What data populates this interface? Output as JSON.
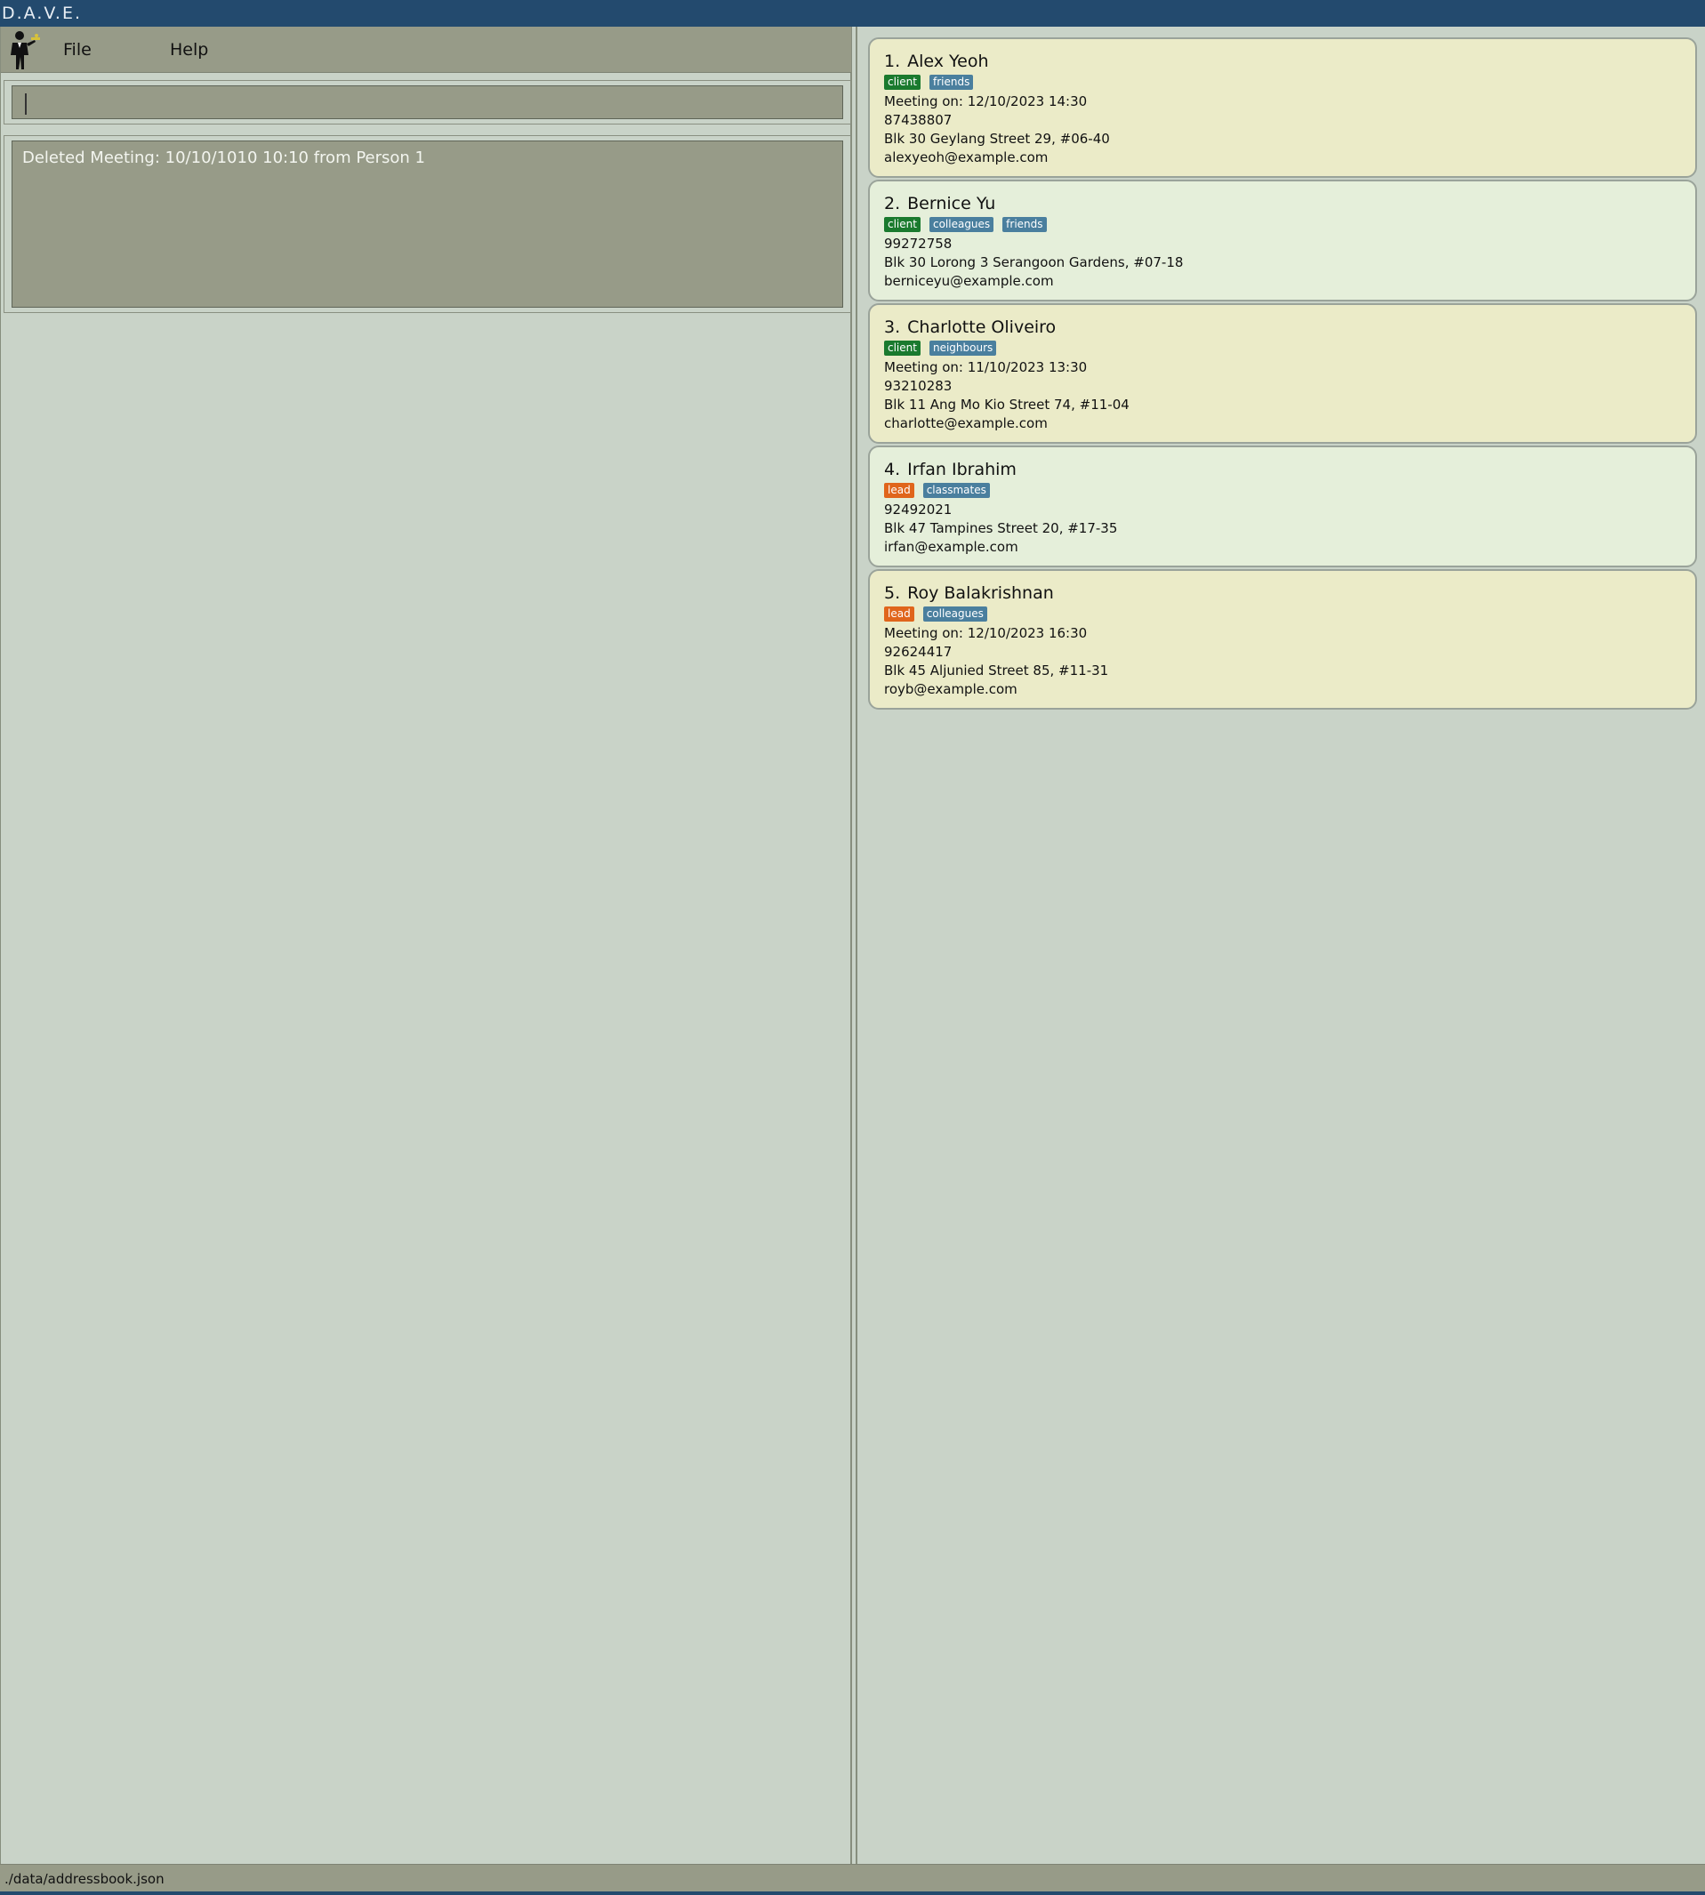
{
  "window": {
    "title": "D.A.V.E."
  },
  "menubar": {
    "file_label": "File",
    "help_label": "Help"
  },
  "command": {
    "value": "",
    "placeholder": ""
  },
  "result": {
    "message": "Deleted Meeting: 10/10/1010 10:10 from Person 1"
  },
  "persons": [
    {
      "index": "1.",
      "name": "Alex Yeoh",
      "tags": [
        {
          "label": "client",
          "color": "#1a7a2e"
        },
        {
          "label": "friends",
          "color": "#4a7f9e"
        }
      ],
      "meeting": "Meeting on: 12/10/2023 14:30",
      "phone": "87438807",
      "address": "Blk 30 Geylang Street 29, #06-40",
      "email": "alexyeoh@example.com"
    },
    {
      "index": "2.",
      "name": "Bernice Yu",
      "tags": [
        {
          "label": "client",
          "color": "#1a7a2e"
        },
        {
          "label": "colleagues",
          "color": "#4a7f9e"
        },
        {
          "label": "friends",
          "color": "#4a7f9e"
        }
      ],
      "meeting": "",
      "phone": "99272758",
      "address": "Blk 30 Lorong 3 Serangoon Gardens, #07-18",
      "email": "berniceyu@example.com"
    },
    {
      "index": "3.",
      "name": "Charlotte Oliveiro",
      "tags": [
        {
          "label": "client",
          "color": "#1a7a2e"
        },
        {
          "label": "neighbours",
          "color": "#4a7f9e"
        }
      ],
      "meeting": "Meeting on: 11/10/2023 13:30",
      "phone": "93210283",
      "address": "Blk 11 Ang Mo Kio Street 74, #11-04",
      "email": "charlotte@example.com"
    },
    {
      "index": "4.",
      "name": "Irfan Ibrahim",
      "tags": [
        {
          "label": "lead",
          "color": "#e0651b"
        },
        {
          "label": "classmates",
          "color": "#4a7f9e"
        }
      ],
      "meeting": "",
      "phone": "92492021",
      "address": "Blk 47 Tampines Street 20, #17-35",
      "email": "irfan@example.com"
    },
    {
      "index": "5.",
      "name": "Roy Balakrishnan",
      "tags": [
        {
          "label": "lead",
          "color": "#e0651b"
        },
        {
          "label": "colleagues",
          "color": "#4a7f9e"
        }
      ],
      "meeting": "Meeting on: 12/10/2023 16:30",
      "phone": "92624417",
      "address": "Blk 45 Aljunied Street 85, #11-31",
      "email": "royb@example.com"
    }
  ],
  "status": {
    "path": "./data/addressbook.json"
  },
  "colors": {
    "titlebar": "#234a6e",
    "card_odd": "#ebebc8",
    "card_even": "#e5efda",
    "tag_client": "#1a7a2e",
    "tag_lead": "#e0651b",
    "tag_default": "#4a7f9e"
  },
  "icons": {
    "app": "butler-person-icon"
  }
}
